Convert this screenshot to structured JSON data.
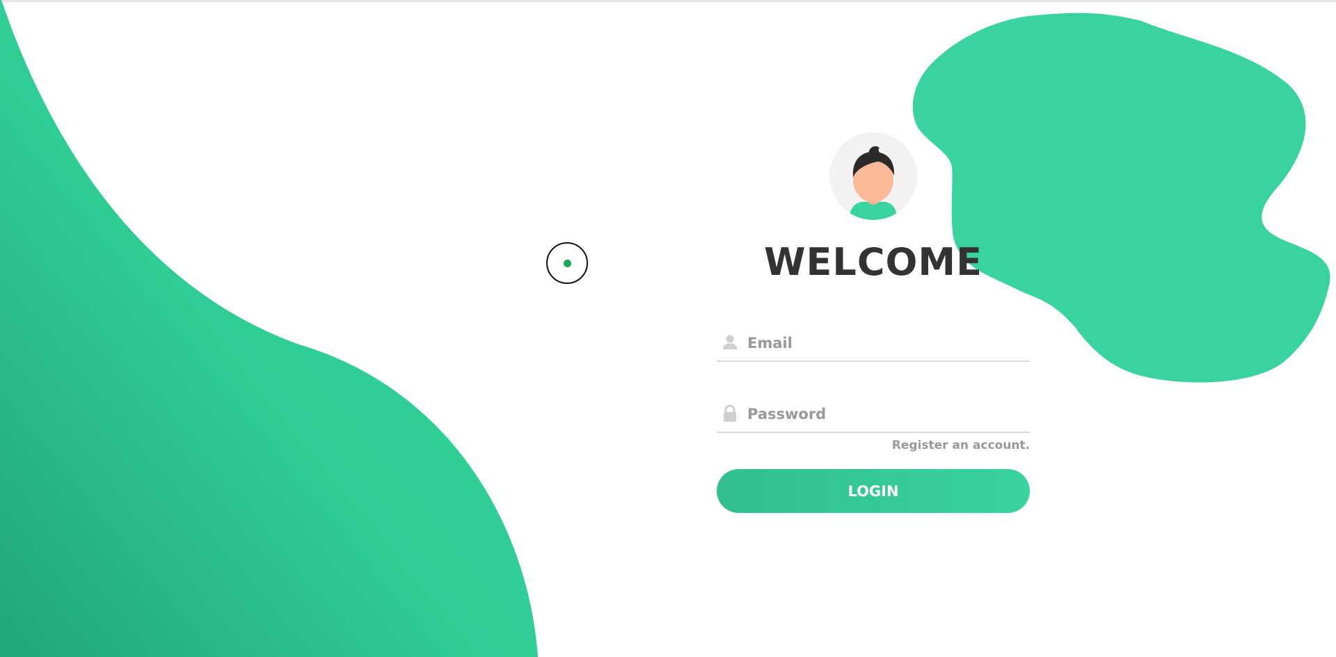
{
  "colors": {
    "accent": "#38d39f",
    "accent_dark": "#32be8f",
    "wave_light": "#32d49a",
    "wave_dark": "#22a57b",
    "blob": "#38d39f",
    "title": "#333333",
    "placeholder": "#999999",
    "underline": "#d9d9d9",
    "avatar_bg": "#f2f2f2",
    "cursor_dot": "#17a760"
  },
  "login_form": {
    "title": "WELCOME",
    "email": {
      "placeholder": "Email",
      "icon": "user-icon"
    },
    "password": {
      "placeholder": "Password",
      "icon": "lock-icon"
    },
    "register_link": "Register an account.",
    "login_button": "LOGIN"
  },
  "avatar": {
    "icon": "user-avatar-illustration"
  },
  "cursor": {
    "icon": "cursor-ring-icon"
  }
}
